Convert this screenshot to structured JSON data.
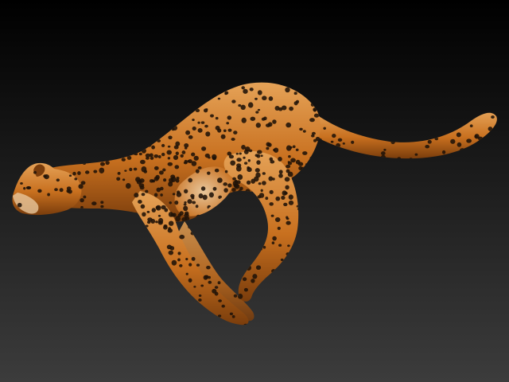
{
  "scene": {
    "subject": "cheetah",
    "pose": "running",
    "background_top": "#000000",
    "background_bottom": "#3c3c3c",
    "fur_base": "#c8701f",
    "fur_light": "#e5a257",
    "fur_shadow": "#7a3d0c",
    "belly": "#e8c79c",
    "spot_color": "#1f1208"
  }
}
